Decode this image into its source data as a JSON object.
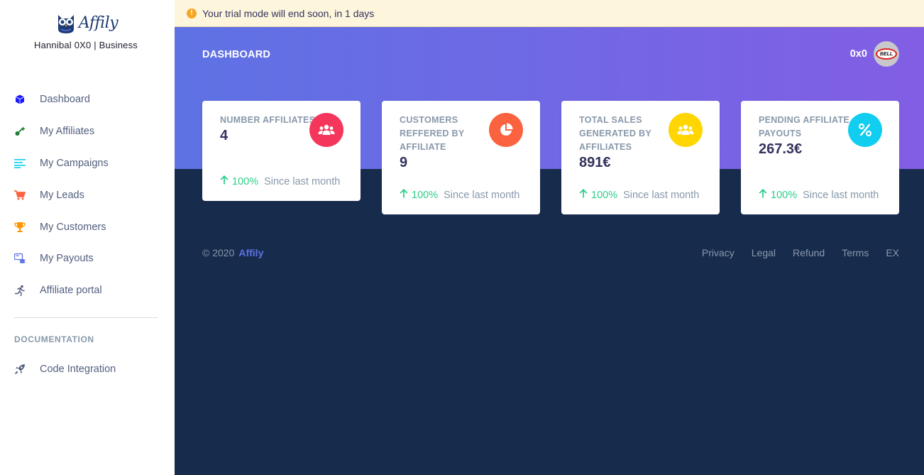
{
  "brand": {
    "name": "Affily",
    "subtitle": "Hannibal 0X0 | Business"
  },
  "sidebar": {
    "items": [
      {
        "label": "Dashboard",
        "icon": "cube-icon",
        "color": "#1a1aff"
      },
      {
        "label": "My Affiliates",
        "icon": "key-icon",
        "color": "#1e7e34"
      },
      {
        "label": "My Campaigns",
        "icon": "list-icon",
        "color": "#11cdef"
      },
      {
        "label": "My Leads",
        "icon": "cart-icon",
        "color": "#fb6340"
      },
      {
        "label": "My Customers",
        "icon": "trophy-icon",
        "color": "#ff9500"
      },
      {
        "label": "My Payouts",
        "icon": "payout-icon",
        "color": "#5e72e4"
      },
      {
        "label": "Affiliate portal",
        "icon": "running-icon",
        "color": "#525f7f"
      }
    ],
    "doc_heading": "DOCUMENTATION",
    "doc_items": [
      {
        "label": "Code Integration",
        "icon": "rocket-icon",
        "color": "#525f7f"
      }
    ]
  },
  "trial": {
    "text": "Your trial mode will end soon, in 1 days",
    "icon": "warning-icon"
  },
  "header": {
    "title": "DASHBOARD",
    "user": "0x0",
    "avatar_text": "BELL"
  },
  "cards": [
    {
      "title": "NUMBER AFFILIATES",
      "value": "4",
      "icon": "users-icon",
      "color": "#f5365c",
      "change": "100%",
      "since": "Since last month"
    },
    {
      "title": "CUSTOMERS REFFERED BY AFFILIATE",
      "value": "9",
      "icon": "pie-chart-icon",
      "color": "#fb6340",
      "change": "100%",
      "since": "Since last month"
    },
    {
      "title": "TOTAL SALES GENERATED BY AFFILIATES",
      "value": "891€",
      "icon": "users-icon",
      "color": "#ffd600",
      "change": "100%",
      "since": "Since last month"
    },
    {
      "title": "PENDING AFFILIATE PAYOUTS",
      "value": "267.3€",
      "icon": "percent-icon",
      "color": "#11cdef",
      "change": "100%",
      "since": "Since last month"
    }
  ],
  "footer": {
    "copyright": "© 2020",
    "brand_link": "Affily",
    "links": [
      "Privacy",
      "Legal",
      "Refund",
      "Terms",
      "EX"
    ]
  }
}
